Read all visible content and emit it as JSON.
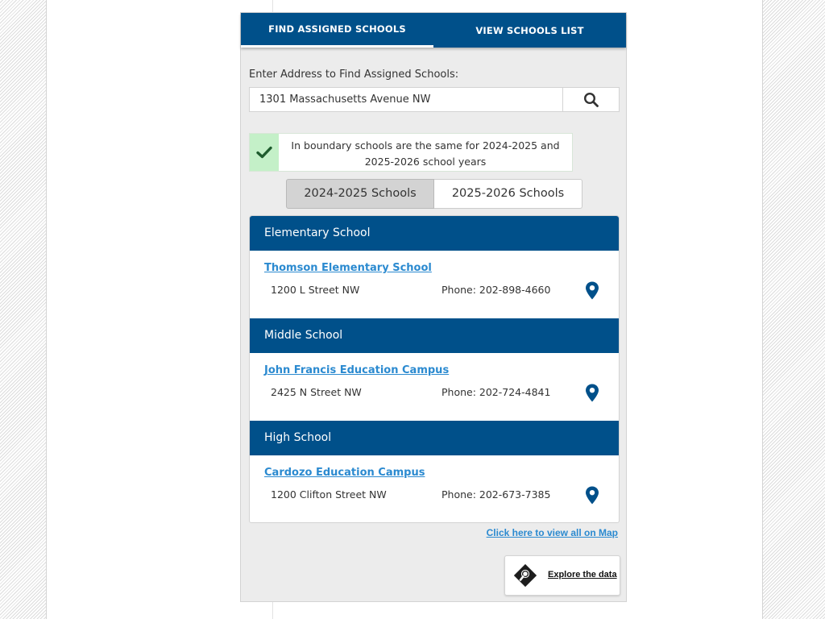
{
  "tabs": {
    "find_label": "FIND ASSIGNED SCHOOLS",
    "view_label": "VIEW SCHOOLS LIST"
  },
  "search": {
    "label": "Enter Address to Find Assigned Schools:",
    "value": "1301 Massachusetts Avenue NW",
    "button_icon": "search-icon"
  },
  "notice": {
    "icon": "checkmark-icon",
    "line1": "In boundary schools are the same for 2024-2025 and",
    "line2": "2025-2026 school years"
  },
  "year_toggle": {
    "options": [
      "2024-2025 Schools",
      "2025-2026 Schools"
    ],
    "selected": "2024-2025 Schools"
  },
  "levels": [
    {
      "heading": "Elementary School",
      "school": "Thomson Elementary School",
      "address": "1200 L Street NW",
      "phone": "Phone: 202-898-4660",
      "icon": "map-pin-icon"
    },
    {
      "heading": "Middle School",
      "school": "John Francis Education Campus",
      "address": "2425 N Street NW",
      "phone": "Phone: 202-724-4841",
      "icon": "map-pin-icon"
    },
    {
      "heading": "High School",
      "school": "Cardozo Education Campus",
      "address": "1200 Clifton Street NW",
      "phone": "Phone: 202-673-7385",
      "icon": "map-pin-icon"
    }
  ],
  "map_link": "Click here to view all on Map",
  "explore": {
    "label": "Explore the data",
    "icon": "magnifier-data-icon"
  },
  "colors": {
    "brand_blue": "#00508a",
    "link_blue": "#2b8ad0",
    "success_green_bg": "#c4f0c8",
    "checkmark": "#1f5c2e"
  }
}
